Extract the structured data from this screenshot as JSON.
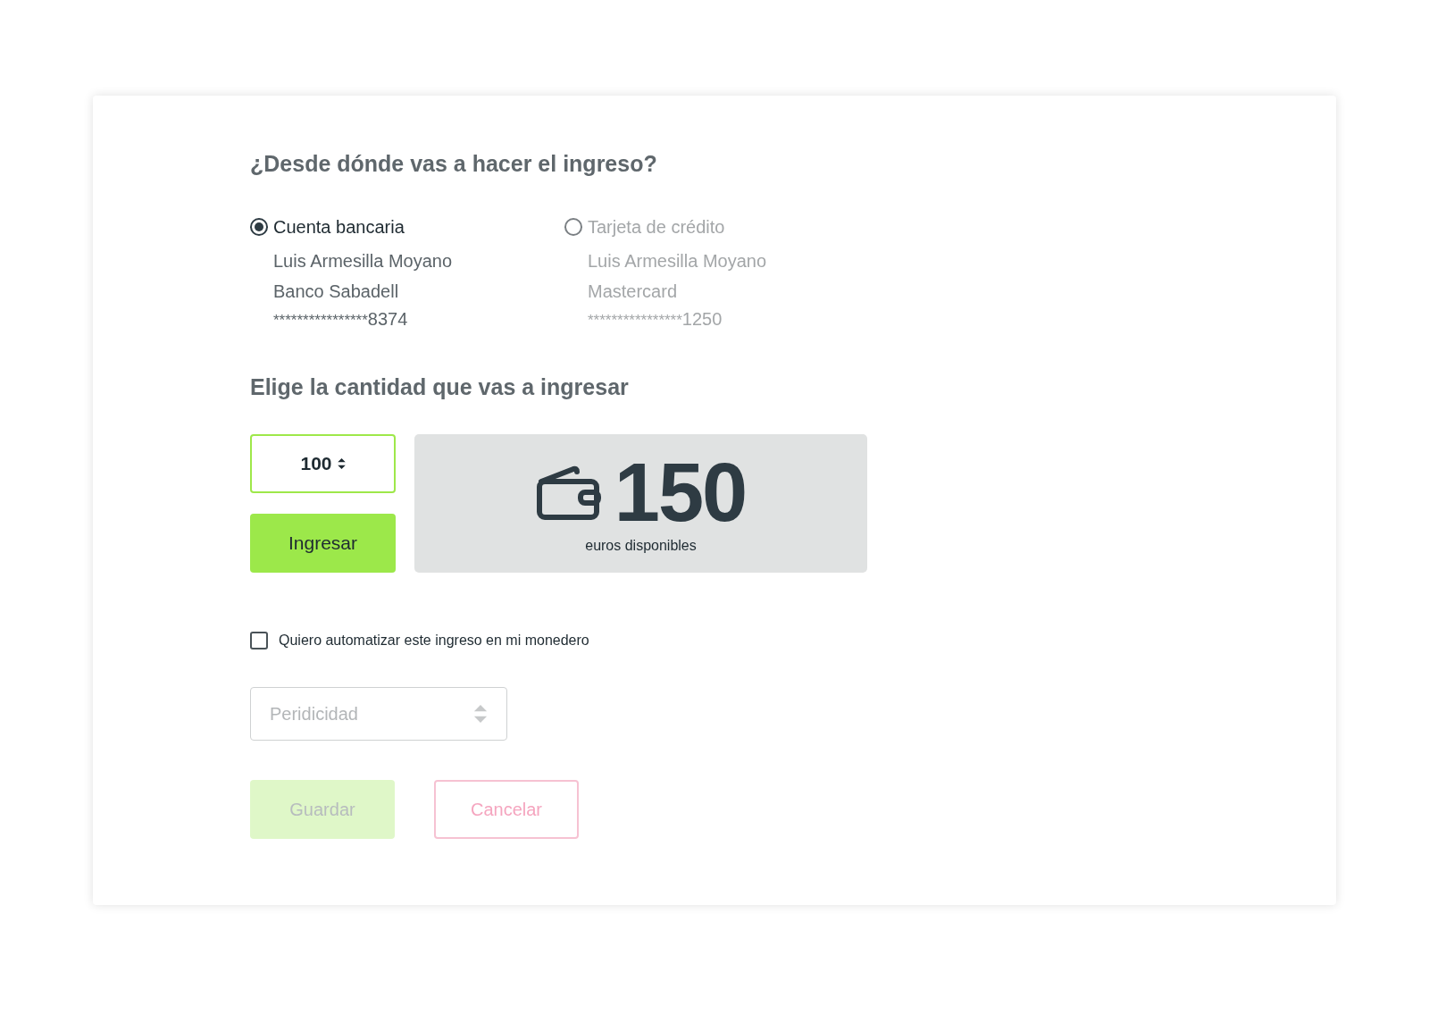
{
  "source": {
    "title": "¿Desde dónde vas a hacer el ingreso?",
    "options": [
      {
        "label": "Cuenta bancaria",
        "selected": true,
        "lines": [
          "Luis Armesilla Moyano",
          "Banco Sabadell"
        ],
        "masked": "****************",
        "last_digits": "8374"
      },
      {
        "label": "Tarjeta de crédito",
        "selected": false,
        "lines": [
          "Luis Armesilla Moyano",
          "Mastercard"
        ],
        "masked": "****************",
        "last_digits": "1250"
      }
    ]
  },
  "amount": {
    "title": "Elige la cantidad que vas a ingresar",
    "value": "100",
    "submit": "Ingresar",
    "balance": "150",
    "balance_caption": "euros disponibles"
  },
  "automate": {
    "label": "Quiero automatizar este ingreso en mi monedero",
    "checked": false
  },
  "periodicity": {
    "placeholder": "Peridicidad",
    "disabled": true
  },
  "actions": [
    {
      "kind": "save",
      "label": "Guardar",
      "disabled": true
    },
    {
      "kind": "cancel",
      "label": "Cancelar",
      "disabled": true
    }
  ]
}
